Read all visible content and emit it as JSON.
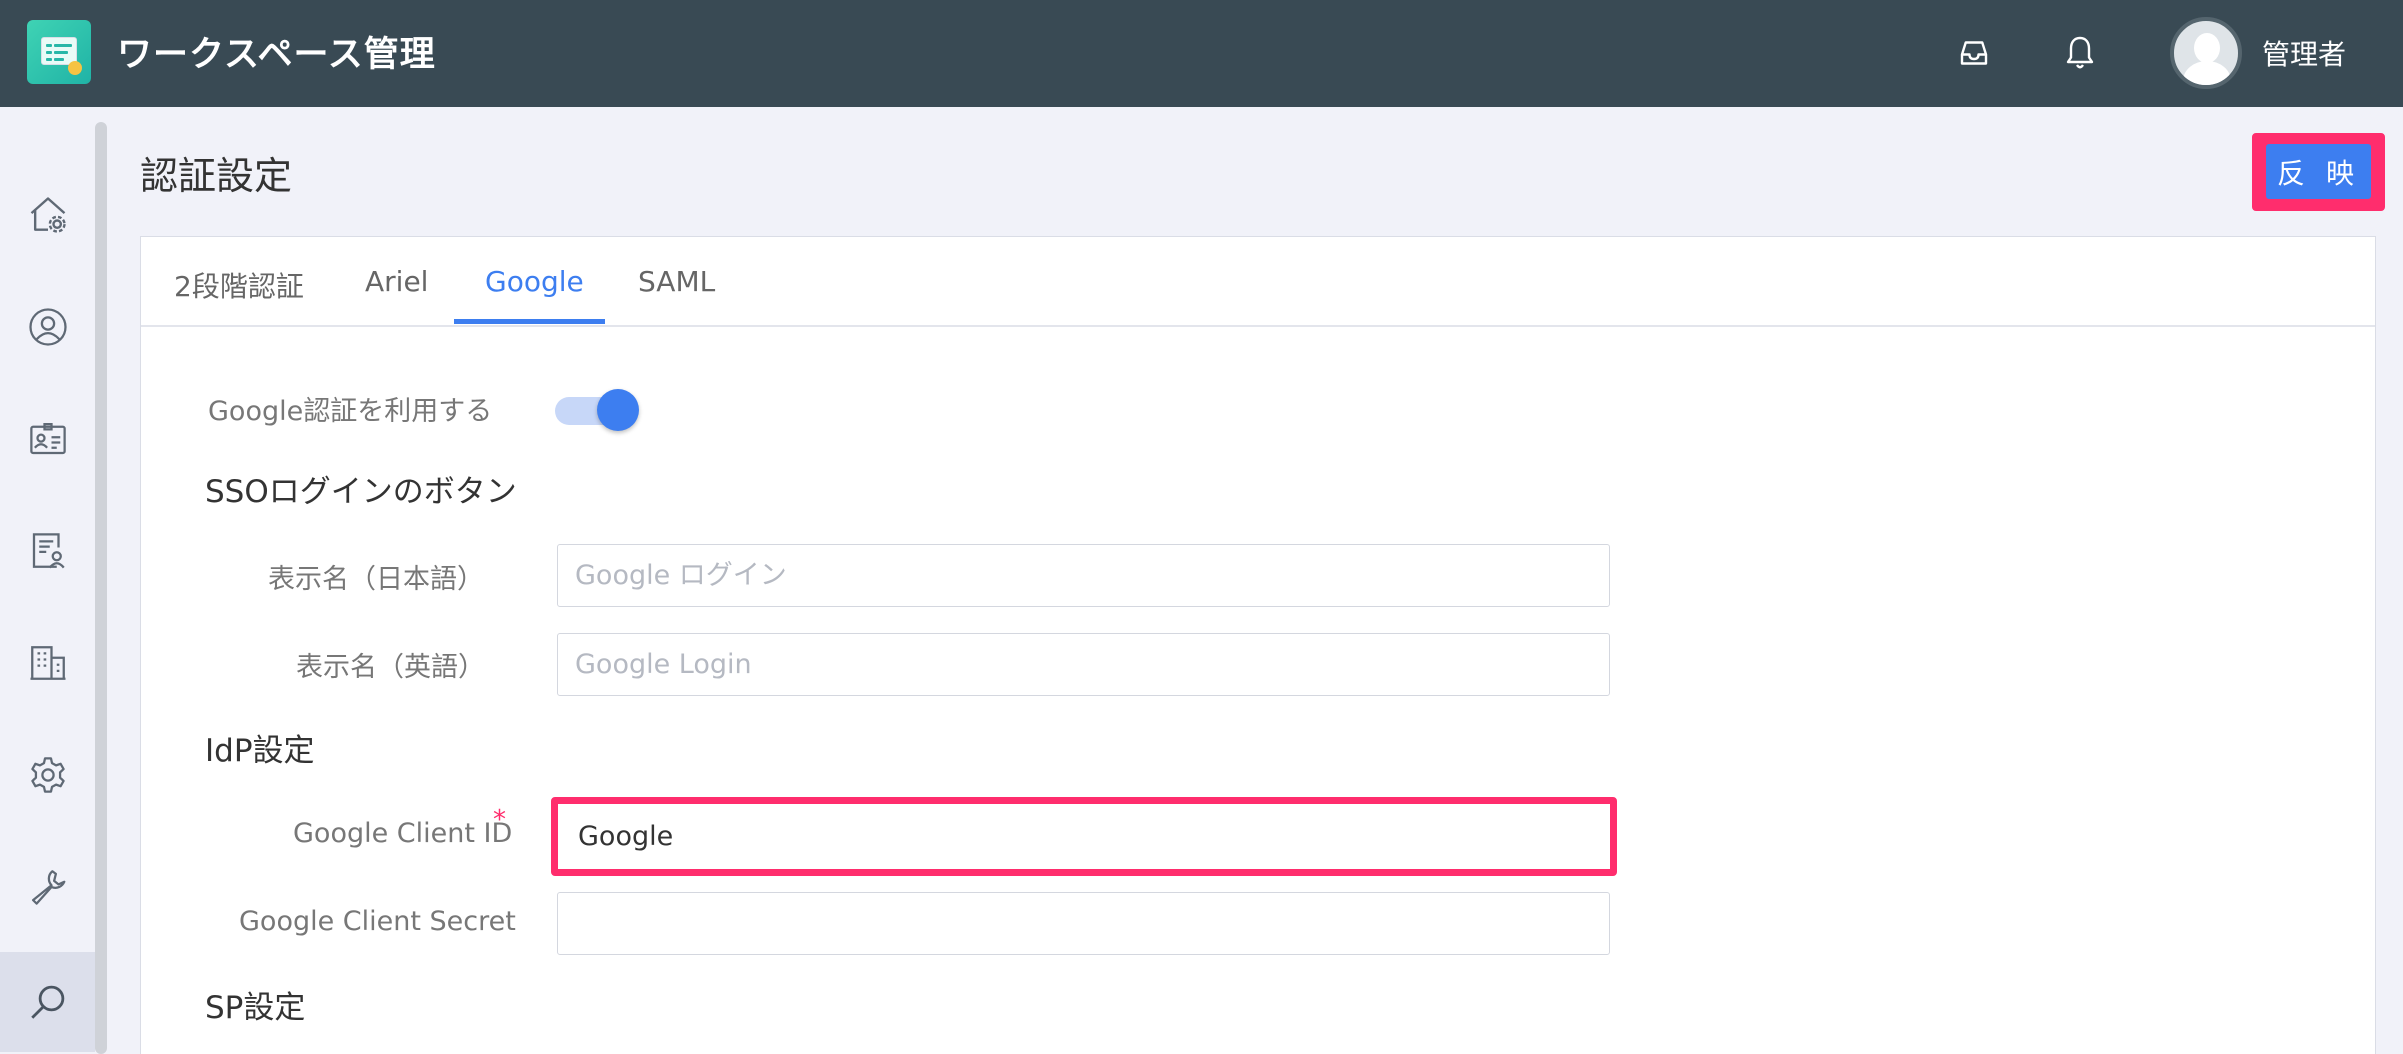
{
  "header": {
    "app_title": "ワークスペース管理",
    "user_name": "管理者"
  },
  "page": {
    "title": "認証設定",
    "apply_label": "反 映"
  },
  "tabs": [
    "2段階認証",
    "Ariel",
    "Google",
    "SAML"
  ],
  "active_tab": "Google",
  "form": {
    "use_google_label": "Google認証を利用する",
    "use_google_enabled": true,
    "sso_section": "SSOログインのボタン",
    "display_name_ja_label": "表示名（日本語）",
    "display_name_ja_placeholder": "Google ログイン",
    "display_name_en_label": "表示名（英語）",
    "display_name_en_placeholder": "Google Login",
    "idp_section": "IdP設定",
    "client_id_label": "Google Client ID",
    "client_id_required_mark": "*",
    "client_id_value": "Google",
    "client_secret_label": "Google Client Secret",
    "client_secret_value": "",
    "sp_section": "SP設定"
  },
  "colors": {
    "header_bg": "#394a54",
    "accent": "#3d7ef0",
    "highlight": "#ff2d6d"
  },
  "icons": {
    "sidebar": [
      "home-settings-icon",
      "user-circle-icon",
      "id-card-icon",
      "document-user-icon",
      "building-icon",
      "gear-icon",
      "wrench-icon",
      "search-icon"
    ],
    "header": [
      "inbox-icon",
      "bell-icon"
    ]
  }
}
